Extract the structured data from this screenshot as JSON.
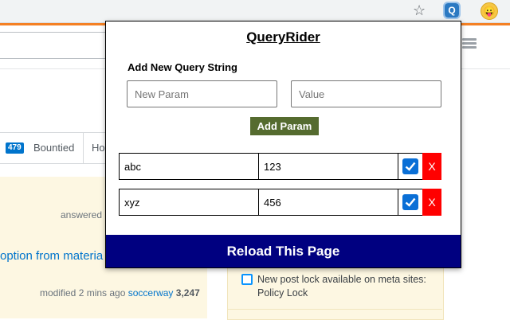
{
  "browser": {
    "star_icon": "star-icon",
    "extension_icon_label": "Q",
    "profile_icon": "emoji-face-icon",
    "accent_color": "#f48024"
  },
  "background_page": {
    "tabs": {
      "bountied_count": "479",
      "bountied_label": "Bountied",
      "hot_label": "Ho"
    },
    "question": {
      "answered_text": "answered",
      "title": "option from materia",
      "modified_text": "modified 2 mins ago",
      "user": "soccerway",
      "reputation": "3,247"
    },
    "sidebar": {
      "notice": "New post lock available on meta sites: Policy Lock"
    }
  },
  "popup": {
    "title": "QueryRider",
    "add_heading": "Add New Query String",
    "param_placeholder": "New Param",
    "value_placeholder": "Value",
    "add_button": "Add Param",
    "params": [
      {
        "key": "abc",
        "value": "123",
        "enabled": true,
        "delete_label": "X"
      },
      {
        "key": "xyz",
        "value": "456",
        "enabled": true,
        "delete_label": "X"
      }
    ],
    "reload_button": "Reload This Page",
    "colors": {
      "add_button": "#556b2f",
      "delete_button": "#ff0000",
      "reload_button": "#000080",
      "checkbox": "#0a6fd6"
    }
  }
}
